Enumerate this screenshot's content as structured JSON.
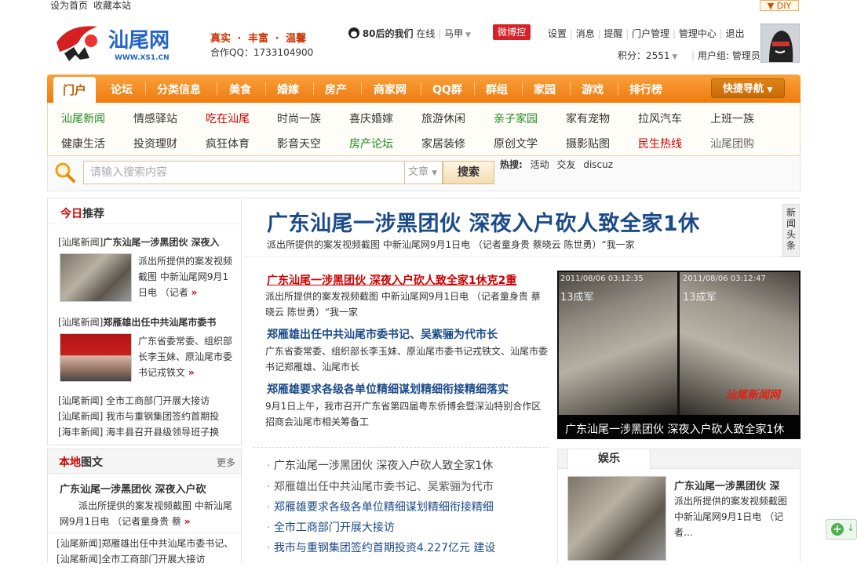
{
  "topbar": {
    "set_home": "设为首页",
    "bookmark": "收藏本站",
    "diy": "DIY"
  },
  "header": {
    "logo_text": "汕尾网",
    "logo_url_text": "WWW.XS1.CN",
    "slogan": [
      "真实",
      "丰富",
      "温馨"
    ],
    "qq_text": "合作QQ：1733104900",
    "group_name": "80后的我们",
    "online": "在线",
    "user": "马甲",
    "weibo": "微博控",
    "links": [
      "设置",
      "消息",
      "提醒",
      "门户管理",
      "管理中心",
      "退出"
    ],
    "points": "积分：2551",
    "usergroup": "用户组: 管理员"
  },
  "nav": {
    "home": "门户",
    "items": [
      "论坛",
      "分类信息",
      "美食",
      "婚嫁",
      "房产",
      "商家网",
      "QQ群",
      "群组",
      "家园",
      "游戏",
      "排行榜"
    ],
    "quick": "快捷导航"
  },
  "subnav": {
    "row1": [
      "汕尾新闻",
      "情感驿站",
      "吃在汕尾",
      "时尚一族",
      "喜庆婚嫁",
      "旅游休闲",
      "亲子家园",
      "家有宠物",
      "拉风汽车",
      "上班一族"
    ],
    "row2": [
      "健康生活",
      "投资理财",
      "疯狂体育",
      "影音天空",
      "房产论坛",
      "家居装修",
      "原创文学",
      "摄影贴图",
      "民生热线",
      "汕尾团购"
    ]
  },
  "search": {
    "placeholder": "请输入搜索内容",
    "type": "文章",
    "button": "搜索",
    "hot_label": "热搜:",
    "hot": [
      "活动",
      "交友",
      "discuz"
    ]
  },
  "today": {
    "title_a": "今日",
    "title_b": "推荐",
    "items": [
      {
        "tag": "[汕尾新闻]",
        "title": "广东汕尾一涉黑团伙 深夜入",
        "desc": "派出所提供的案发视频截图 中新汕尾网9月1日电 （记者"
      },
      {
        "tag": "[汕尾新闻]",
        "title": "郑雁雄出任中共汕尾市委书",
        "desc": "广东省委常委、组织部长李玉妹、原汕尾市委书记戎铁文"
      }
    ],
    "list": [
      "[汕尾新闻] 全市工商部门开展大接访",
      "[汕尾新闻] 我市与重钢集团签约首期投",
      "[海丰新闻] 海丰县召开县级领导班子换"
    ]
  },
  "local": {
    "title_a": "本地",
    "title_b": "图文",
    "more": "更多",
    "item_title": "广东汕尾一涉黑团伙 深夜入户砍",
    "item_desc": "派出所提供的案发视频截图 中新汕尾网9月1日电 （记者童身贵 蔡",
    "bottom1": "[汕尾新闻]郑雁雄出任中共汕尾市委书记、",
    "bottom2": "[汕尾新闻]全市工商部门开展大接访"
  },
  "headline": {
    "title": "广东汕尾一涉黑团伙 深夜入户砍人致全家1休",
    "desc": "派出所提供的案发视频截图 中新汕尾网9月1日电 （记者童身贵 蔡晓云 陈世勇）“我一家",
    "side_tab": "新闻头条"
  },
  "news": [
    {
      "title": "广东汕尾一涉黑团伙 深夜入户砍人致全家1休克2重",
      "desc": "派出所提供的案发视频截图 中新汕尾网9月1日电 （记者童身贵 蔡晓云 陈世勇）“我一家"
    },
    {
      "title": "郑雁雄出任中共汕尾市委书记、吴紫骊为代市长",
      "desc": "广东省委常委、组织部长李玉妹、原汕尾市委书记戎铁文、汕尾市委书记郑雁雄、汕尾市长"
    },
    {
      "title": "郑雁雄要求各级各单位精细谋划精细衔接精细落实",
      "desc": "9月1日上午，我市召开广东省第四届粤东侨博会暨深汕特别合作区招商会汕尾市相关筹备工"
    }
  ],
  "bullets": [
    "广东汕尾一涉黑团伙 深夜入户砍人致全家1休",
    "郑雁雄出任中共汕尾市委书记、吴紫骊为代市",
    "郑雁雄要求各级各单位精细谋划精细衔接精细",
    "全市工商部门开展大接访",
    "我市与重钢集团签约首期投资4.227亿元 建设"
  ],
  "photo": {
    "caption": "广东汕尾一涉黑团伙 深夜入户砍人致全家1休",
    "watermark": "汕尾新闻网",
    "stamp1": "2011/08/06 03:12:35",
    "stamp2": "2011/08/06 03:12:47",
    "cam": "13成军"
  },
  "ent": {
    "tab": "娱乐",
    "title": "广东汕尾一涉黑团伙 深",
    "desc": "派出所提供的案发视频截图 中新汕尾网9月1日电 （记者…"
  }
}
